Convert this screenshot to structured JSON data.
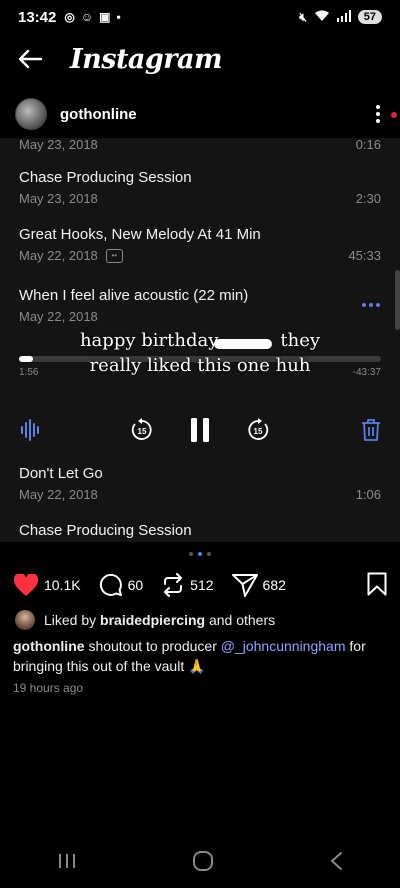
{
  "status": {
    "time": "13:42",
    "battery": "57"
  },
  "app": {
    "title": "Instagram"
  },
  "profile": {
    "username": "gothonline"
  },
  "tracks": [
    {
      "title": "Chase Producing Session",
      "date": "May 23, 2018",
      "duration": "2:30"
    },
    {
      "title": "Great Hooks, New Melody At 41 Min",
      "date": "May 22, 2018",
      "duration": "45:33"
    },
    {
      "title": "When I feel alive acoustic (22 min)",
      "date": "May 22, 2018",
      "duration": ""
    },
    {
      "title": "Don't Let Go",
      "date": "May 22, 2018",
      "duration": "1:06"
    },
    {
      "title": "Chase Producing Session",
      "date": "",
      "duration": ""
    }
  ],
  "partial_top": {
    "date": "May 23, 2018",
    "duration": "0:16"
  },
  "player": {
    "elapsed": "1:56",
    "remaining": "-43:37",
    "progress": 0.04,
    "skip_back": "15",
    "skip_forward": "15"
  },
  "overlay_caption": "happy birthday f***er they really liked this one huh",
  "overlay_line1": "happy birthday",
  "overlay_line1b": "they",
  "overlay_line2": "really liked this one huh",
  "carousel": {
    "count": 3,
    "active": 1
  },
  "actions": {
    "likes": "10.1K",
    "comments": "60",
    "reposts": "512",
    "shares": "682"
  },
  "liked_by": {
    "prefix": "Liked by",
    "user": "braidedpiercing",
    "suffix": "and others"
  },
  "caption": {
    "user": "gothonline",
    "text_before": "shoutout to producer",
    "mention": "@_johncunningham",
    "text_after": "for bringing this out of the vault 🙏"
  },
  "posted": "19 hours ago",
  "colors": {
    "accent": "#5a7de8",
    "like": "#ff3040",
    "mention": "#8fa3ff"
  }
}
